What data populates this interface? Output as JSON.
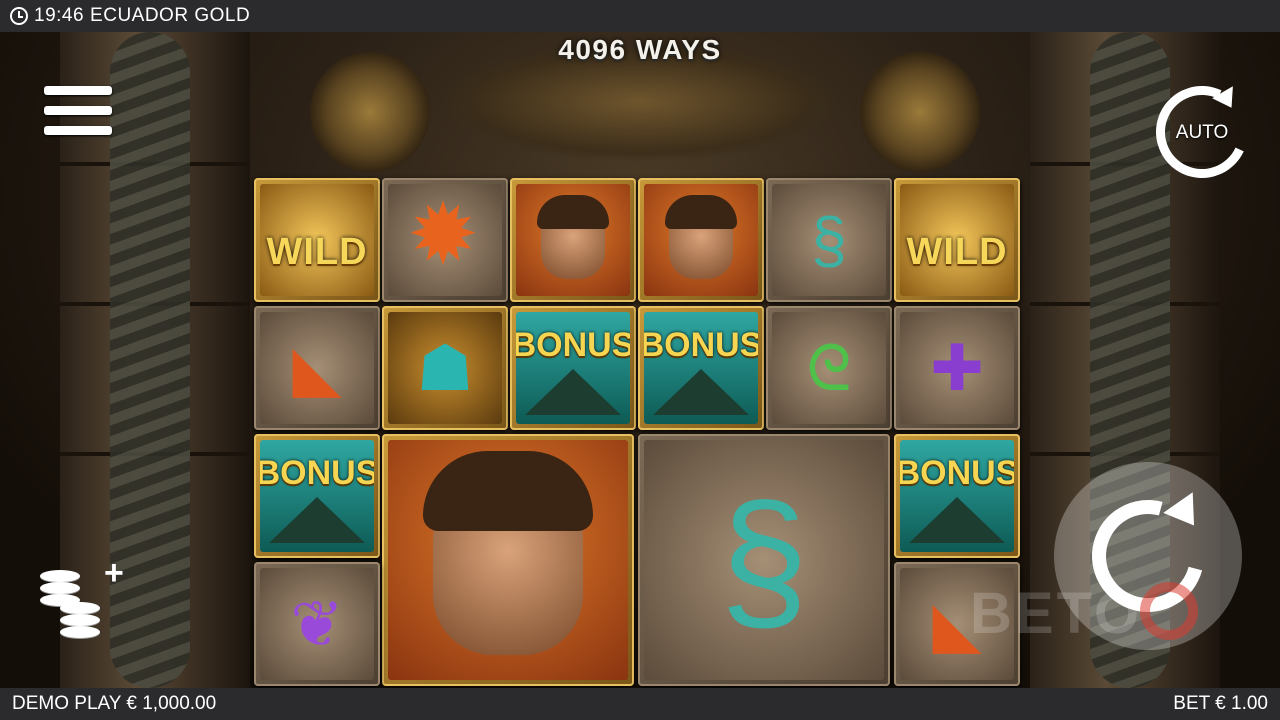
{
  "topbar": {
    "time": "19:46",
    "title": "ECUADOR GOLD"
  },
  "ways_label": "4096 WAYS",
  "buttons": {
    "auto_label": "AUTO"
  },
  "bottombar": {
    "demo_label": "DEMO PLAY € 1,000.00",
    "bet_label": "BET € 1.00"
  },
  "watermark": "BETO",
  "symbols": {
    "wild": "WILD",
    "bonus": "BONUS"
  },
  "reels": [
    [
      "wild",
      "jaguar",
      "bonus",
      "feather"
    ],
    [
      "sun-stone",
      "mask",
      "explorer-big",
      "explorer-big"
    ],
    [
      "explorer",
      "bonus",
      "explorer-big",
      "explorer-big"
    ],
    [
      "explorer",
      "bonus",
      "snake-big",
      "snake-big"
    ],
    [
      "snake",
      "green-snake",
      "snake-big",
      "snake-big"
    ],
    [
      "wild",
      "purple-cross",
      "bonus",
      "jaguar"
    ]
  ],
  "colors": {
    "bar": "#2b2b2e",
    "gold": "#e8c061",
    "bonus_text": "#f6d552"
  }
}
